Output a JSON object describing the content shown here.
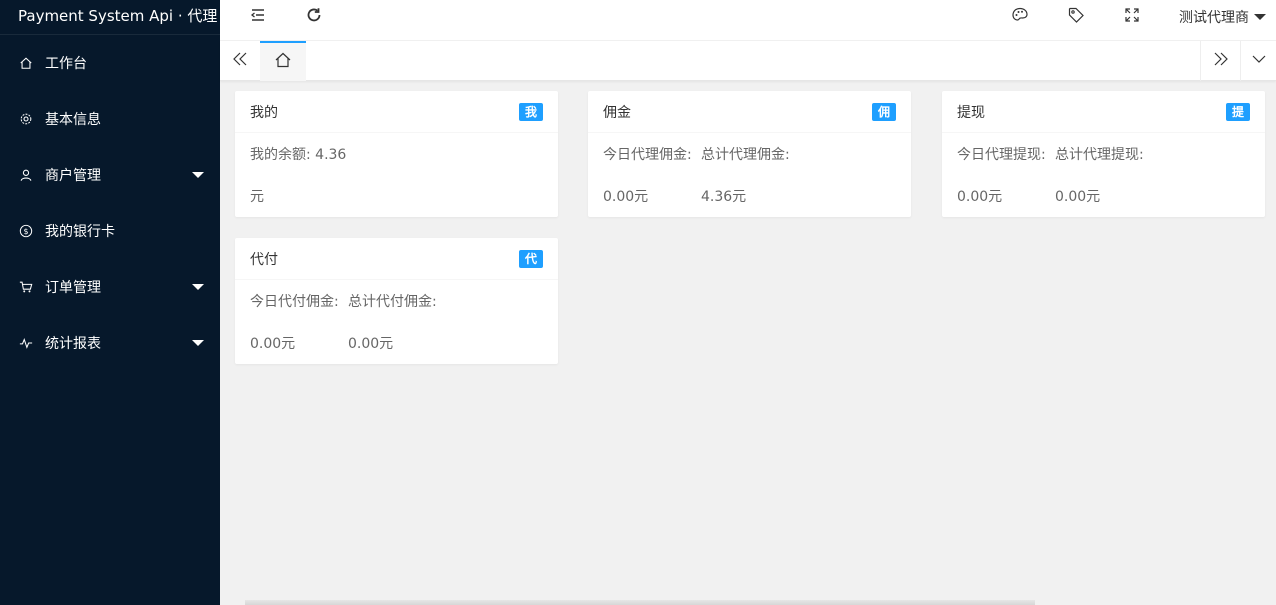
{
  "brand": "Payment System Api · 代理",
  "sidebar": {
    "items": [
      {
        "label": "工作台",
        "icon": "home-icon",
        "has_caret": false
      },
      {
        "label": "基本信息",
        "icon": "gear-icon",
        "has_caret": false
      },
      {
        "label": "商户管理",
        "icon": "user-icon",
        "has_caret": true
      },
      {
        "label": "我的银行卡",
        "icon": "dollar-icon",
        "has_caret": false
      },
      {
        "label": "订单管理",
        "icon": "cart-icon",
        "has_caret": true
      },
      {
        "label": "统计报表",
        "icon": "pulse-icon",
        "has_caret": true
      }
    ]
  },
  "header": {
    "username": "测试代理商"
  },
  "cards": {
    "mine": {
      "title": "我的",
      "badge": "我",
      "balance_label": "我的余额:",
      "balance_value": "4.36",
      "balance_unit": "元"
    },
    "commission": {
      "title": "佣金",
      "badge": "佣",
      "today_label": "今日代理佣金:",
      "total_label": "总计代理佣金:",
      "today_value": "0.00元",
      "total_value": "4.36元"
    },
    "withdraw": {
      "title": "提现",
      "badge": "提",
      "today_label": "今日代理提现:",
      "total_label": "总计代理提现:",
      "today_value": "0.00元",
      "total_value": "0.00元"
    },
    "payout": {
      "title": "代付",
      "badge": "代",
      "today_label": "今日代付佣金:",
      "total_label": "总计代付佣金:",
      "today_value": "0.00元",
      "total_value": "0.00元"
    }
  },
  "colors": {
    "sidebar_bg": "#06182b",
    "accent": "#1e9fff",
    "page_bg": "#f1f1f1"
  }
}
